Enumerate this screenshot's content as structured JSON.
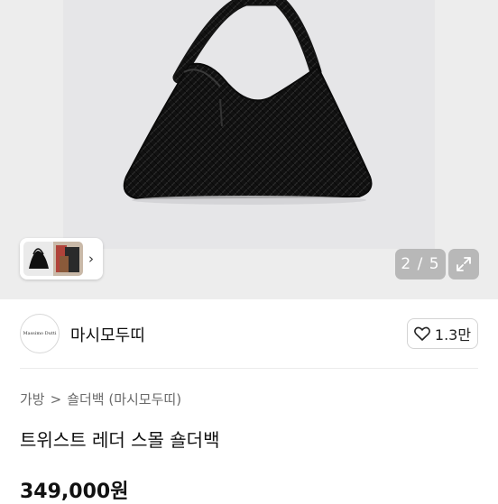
{
  "gallery": {
    "counter": "2 / 5",
    "current_index": 2,
    "total_images": 5
  },
  "seller": {
    "logo_text": "Massimo Dutti",
    "name": "마시모두띠"
  },
  "like": {
    "count": "1.3만"
  },
  "breadcrumb": {
    "category": "가방",
    "separator": ">",
    "subcategory": "숄더백 (마시모두띠)"
  },
  "product": {
    "title": "트위스트 레더 스몰 숄더백",
    "price": "349,000원"
  },
  "colors": {
    "background": "#ffffff",
    "gallery_bg": "#ededed",
    "overlay_button": "#8c8c8c",
    "text_primary": "#111111",
    "text_secondary": "#6b6b6b"
  }
}
